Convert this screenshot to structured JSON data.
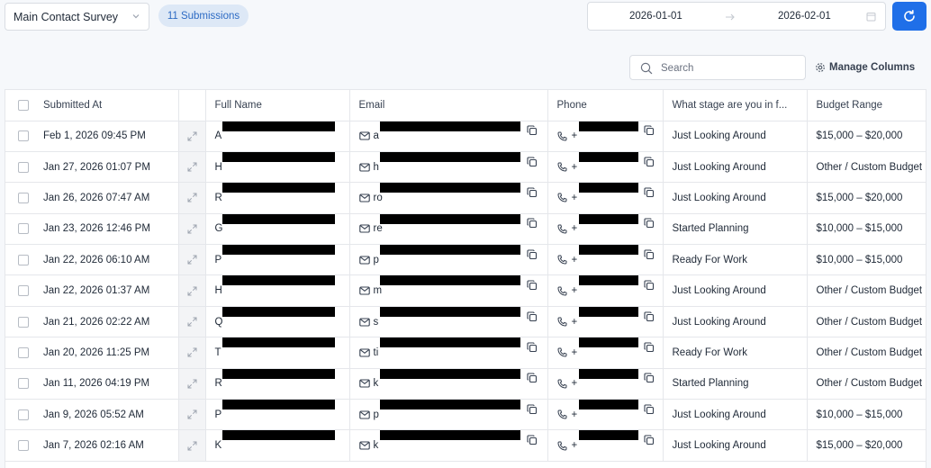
{
  "toolbar": {
    "survey_name": "Main Contact Survey",
    "submissions_badge": "11 Submissions",
    "date_from": "2026-01-01",
    "date_to": "2026-02-01",
    "search_placeholder": "Search",
    "manage_columns_label": "Manage Columns",
    "accent_color": "#1f6fe8"
  },
  "table": {
    "columns": [
      "Submitted At",
      "Full Name",
      "Email",
      "Phone",
      "What stage are you in f...",
      "Budget Range"
    ],
    "rows": [
      {
        "submitted": "Feb 1, 2026 09:45 PM",
        "name_initial": "A",
        "email_initial": "a",
        "phone_prefix": "+",
        "stage": "Just Looking Around",
        "budget": "$15,000 – $20,000"
      },
      {
        "submitted": "Jan 27, 2026 01:07 PM",
        "name_initial": "H",
        "email_initial": "h",
        "phone_prefix": "+",
        "stage": "Just Looking Around",
        "budget": "Other / Custom Budget"
      },
      {
        "submitted": "Jan 26, 2026 07:47 AM",
        "name_initial": "R",
        "email_initial": "ro",
        "phone_prefix": "+",
        "stage": "Just Looking Around",
        "budget": "$15,000 – $20,000"
      },
      {
        "submitted": "Jan 23, 2026 12:46 PM",
        "name_initial": "G",
        "email_initial": "re",
        "phone_prefix": "+",
        "stage": "Started Planning",
        "budget": "$10,000 – $15,000"
      },
      {
        "submitted": "Jan 22, 2026 06:10 AM",
        "name_initial": "P",
        "email_initial": "p",
        "phone_prefix": "+",
        "stage": "Ready For Work",
        "budget": "$10,000 – $15,000"
      },
      {
        "submitted": "Jan 22, 2026 01:37 AM",
        "name_initial": "H",
        "email_initial": "m",
        "phone_prefix": "+",
        "stage": "Just Looking Around",
        "budget": "Other / Custom Budget"
      },
      {
        "submitted": "Jan 21, 2026 02:22 AM",
        "name_initial": "Q",
        "email_initial": "s",
        "phone_prefix": "+",
        "stage": "Just Looking Around",
        "budget": "Other / Custom Budget"
      },
      {
        "submitted": "Jan 20, 2026 11:25 PM",
        "name_initial": "T",
        "email_initial": "ti",
        "phone_prefix": "+",
        "stage": "Ready For Work",
        "budget": "Other / Custom Budget"
      },
      {
        "submitted": "Jan 11, 2026 04:19 PM",
        "name_initial": "R",
        "email_initial": "k",
        "phone_prefix": "+",
        "stage": "Started Planning",
        "budget": "Other / Custom Budget"
      },
      {
        "submitted": "Jan 9, 2026 05:52 AM",
        "name_initial": "P",
        "email_initial": "p",
        "phone_prefix": "+",
        "stage": "Just Looking Around",
        "budget": "$10,000 – $15,000"
      },
      {
        "submitted": "Jan 7, 2026 02:16 AM",
        "name_initial": "K",
        "email_initial": "k",
        "phone_prefix": "+",
        "stage": "Just Looking Around",
        "budget": "$15,000 – $20,000"
      }
    ]
  }
}
